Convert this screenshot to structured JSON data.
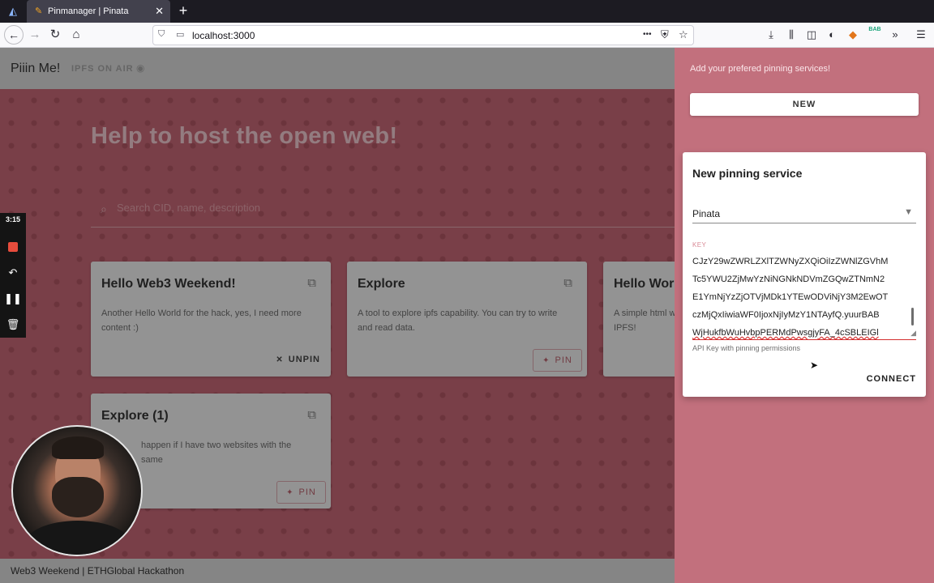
{
  "browser": {
    "tab_title": "Pinmanager | Pinata",
    "tab_close": "✕",
    "new_tab": "+",
    "url": "localhost:3000",
    "more_actions": "•••",
    "extension_badge": "BAB"
  },
  "app": {
    "brand": "Piiin Me!",
    "ipfs_status": "IPFS ON AIR",
    "hero_title": "Help to host the open web!",
    "search_placeholder": "Search CID, name, description",
    "cards": [
      {
        "title": "Hello Web3 Weekend!",
        "description": "Another Hello World for the hack, yes, I need more content :)",
        "action": "UNPIN"
      },
      {
        "title": "Explore",
        "description": "A tool to explore ipfs capability. You can try to write and read data.",
        "action": "PIN"
      },
      {
        "title": "Hello Worl",
        "description": "A simple html w with IPFS!",
        "action": ""
      },
      {
        "title": "Explore (1)",
        "description": "happen if I have two websites with the same",
        "action": "PIN"
      }
    ],
    "footer": "Web3 Weekend | ETHGlobal Hackathon"
  },
  "drawer": {
    "hint": "Add your prefered pinning services!",
    "new_button": "NEW",
    "dialog": {
      "title": "New pinning service",
      "service_selected": "Pinata",
      "key_label": "KEY",
      "key_lines": [
        "CJzY29wZWRLZXlTZWNyZXQiOiIzZWNlZGVhM",
        "Tc5YWU2ZjMwYzNiNGNkNDVmZGQwZTNmN2",
        "E1YmNjYzZjOTVjMDk1YTEwODViNjY3M2EwOT",
        "czMjQxIiwiaWF0IjoxNjIyMzY1NTAyfQ.yuurBAB",
        "WjHukfbWuHvbpPERMdPwsgjyFA_4cSBLEIGl"
      ],
      "key_hint": "API Key with pinning permissions",
      "connect_button": "CONNECT"
    }
  },
  "recorder": {
    "time": "3:15"
  }
}
